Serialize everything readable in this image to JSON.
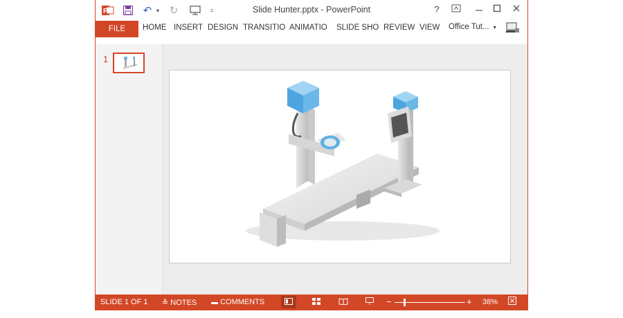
{
  "window": {
    "title": "Slide Hunter.pptx - PowerPoint",
    "app_icon": "powerpoint-icon",
    "controls": {
      "help": "?",
      "restore_ribbon": "⊼",
      "minimize": "—",
      "maximize": "☐",
      "close": "✕"
    }
  },
  "quick_access": {
    "save": "save-icon",
    "undo": "undo-icon",
    "redo": "redo-icon",
    "present": "start-slideshow-icon",
    "customize": "customize-toolbar-icon"
  },
  "ribbon": {
    "file_label": "FILE",
    "tabs": [
      "HOME",
      "INSERT",
      "DESIGN",
      "TRANSITIO",
      "ANIMATIO",
      "SLIDE SHO",
      "REVIEW",
      "VIEW"
    ],
    "account": "Office Tut...",
    "account_caret": "▾"
  },
  "thumbnails": [
    {
      "number": "1"
    }
  ],
  "status_bar": {
    "slide_info": "SLIDE 1 OF 1",
    "notes_label": "NOTES",
    "comments_label": "COMMENTS",
    "zoom_minus": "−",
    "zoom_plus": "+",
    "zoom_level": "38%",
    "zoom_fraction": 0.38
  },
  "colors": {
    "accent": "#d24726",
    "device_blue": "#6ab8e8",
    "device_gray": "#d8d8d8"
  }
}
